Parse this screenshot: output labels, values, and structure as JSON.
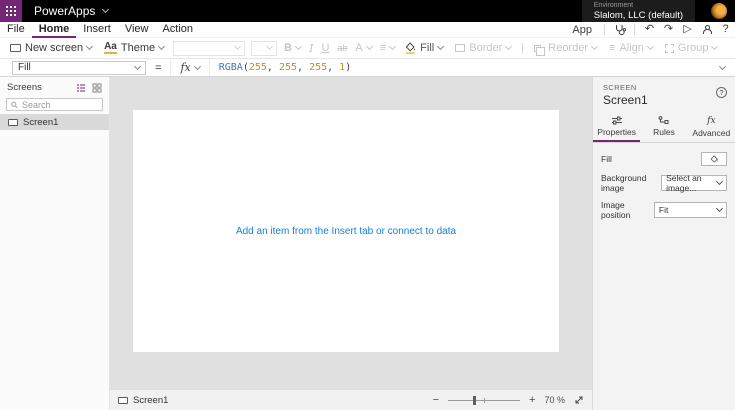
{
  "topbar": {
    "app_name": "PowerApps",
    "environment_label": "Environment",
    "environment_name": "Slalom, LLC (default)"
  },
  "menubar": {
    "items": [
      "File",
      "Home",
      "Insert",
      "View",
      "Action"
    ],
    "active_item": "Home",
    "app_label": "App",
    "icons": {
      "undo": "↶",
      "redo": "↷",
      "play": "▷",
      "help": "?"
    }
  },
  "ribbon": {
    "new_screen": "New screen",
    "theme": "Theme",
    "theme_icon": "Aa",
    "bold": "B",
    "italic": "I",
    "underline": "U",
    "strikethrough": "ab",
    "font_color": "A",
    "align_icon": "≡",
    "fill": "Fill",
    "border": "Border",
    "reorder": "Reorder",
    "align": "Align",
    "group": "Group"
  },
  "formula_bar": {
    "property": "Fill",
    "equals": "=",
    "fx": "fx",
    "tokens": [
      {
        "text": "RGBA",
        "type": "function"
      },
      {
        "text": "(",
        "type": "punct"
      },
      {
        "text": "255",
        "type": "number"
      },
      {
        "text": ", ",
        "type": "punct"
      },
      {
        "text": "255",
        "type": "number"
      },
      {
        "text": ", ",
        "type": "punct"
      },
      {
        "text": "255",
        "type": "number"
      },
      {
        "text": ", ",
        "type": "punct"
      },
      {
        "text": "1",
        "type": "number"
      },
      {
        "text": ")",
        "type": "punct"
      }
    ]
  },
  "screens_panel": {
    "title": "Screens",
    "search_placeholder": "Search",
    "items": [
      {
        "label": "Screen1",
        "selected": true
      }
    ]
  },
  "canvas": {
    "empty_message": "Add an item from the Insert tab or connect to data"
  },
  "properties_panel": {
    "type_label": "SCREEN",
    "object_name": "Screen1",
    "help": "?",
    "tabs": [
      {
        "label": "Properties",
        "active": true
      },
      {
        "label": "Rules",
        "active": false
      },
      {
        "label": "Advanced",
        "active": false
      }
    ],
    "fields": {
      "fill": {
        "label": "Fill"
      },
      "background_image": {
        "label": "Background image",
        "value": "Select an image..."
      },
      "image_position": {
        "label": "Image position",
        "value": "Fit"
      }
    }
  },
  "statusbar": {
    "screen_label": "Screen1",
    "zoom_out": "−",
    "zoom_in": "+",
    "zoom_level": "70 %"
  },
  "colors": {
    "brand": "#742774",
    "canvas_surround": "#e0e0e0",
    "panel_bg": "#f3f3f3",
    "selection": "#d9d9d9",
    "link_blue": "#1380d8",
    "formula_function": "#3b78c3",
    "formula_number": "#bf8f2a"
  }
}
